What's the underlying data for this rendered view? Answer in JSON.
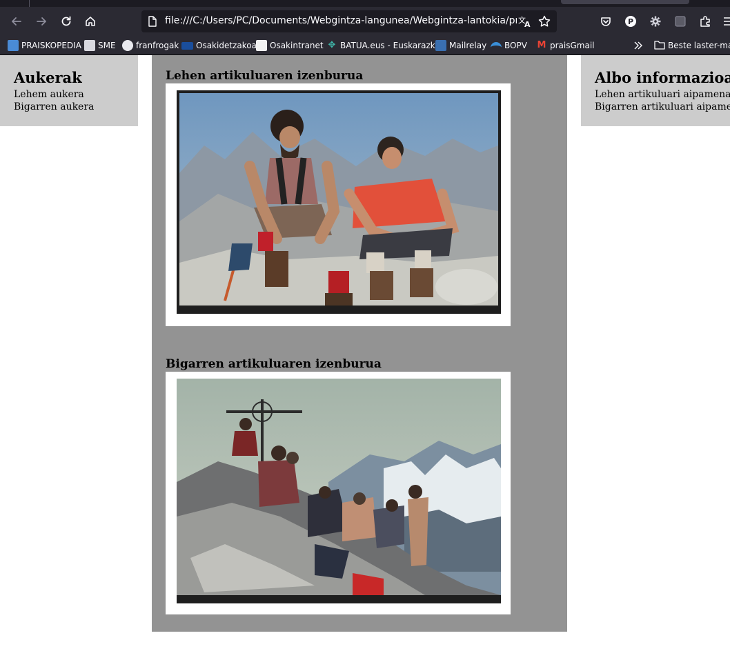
{
  "browser": {
    "url": "file:///C:/Users/PC/Documents/Webgintza-langunea/Webgintza-lantokia/probasei.h",
    "bookmarks": [
      "PRAISKOPEDIA",
      "SME",
      "franfrogak",
      "Osakidetzakoa",
      "Osakintranet",
      "BATUA.eus - Euskarazk...",
      "Mailrelay",
      "BOPV",
      "praisGmail"
    ],
    "other_bookmarks": "Beste laster-mark",
    "avatar_letter": "P",
    "bookmark_more_icon": "double-chevron-right-icon"
  },
  "left": {
    "title": "Aukerak",
    "items": [
      "Lehem aukera",
      "Bigarren aukera"
    ]
  },
  "right": {
    "title": "Albo informazioa",
    "items": [
      "Lehen artikuluari aipamena",
      "Bigarren artikuluari aipamena"
    ]
  },
  "articles": [
    {
      "title": "Lehen artikuluaren izenburua",
      "image": "photo-two-climbers-sitting-on-rocks"
    },
    {
      "title": "Bigarren artikuluaren izenburua",
      "image": "photo-group-of-climbers-at-summit-cross"
    }
  ],
  "colors": {
    "chrome_dark": "#2b2a33",
    "sidebar_grey": "#cccccc",
    "main_grey": "#939393"
  }
}
